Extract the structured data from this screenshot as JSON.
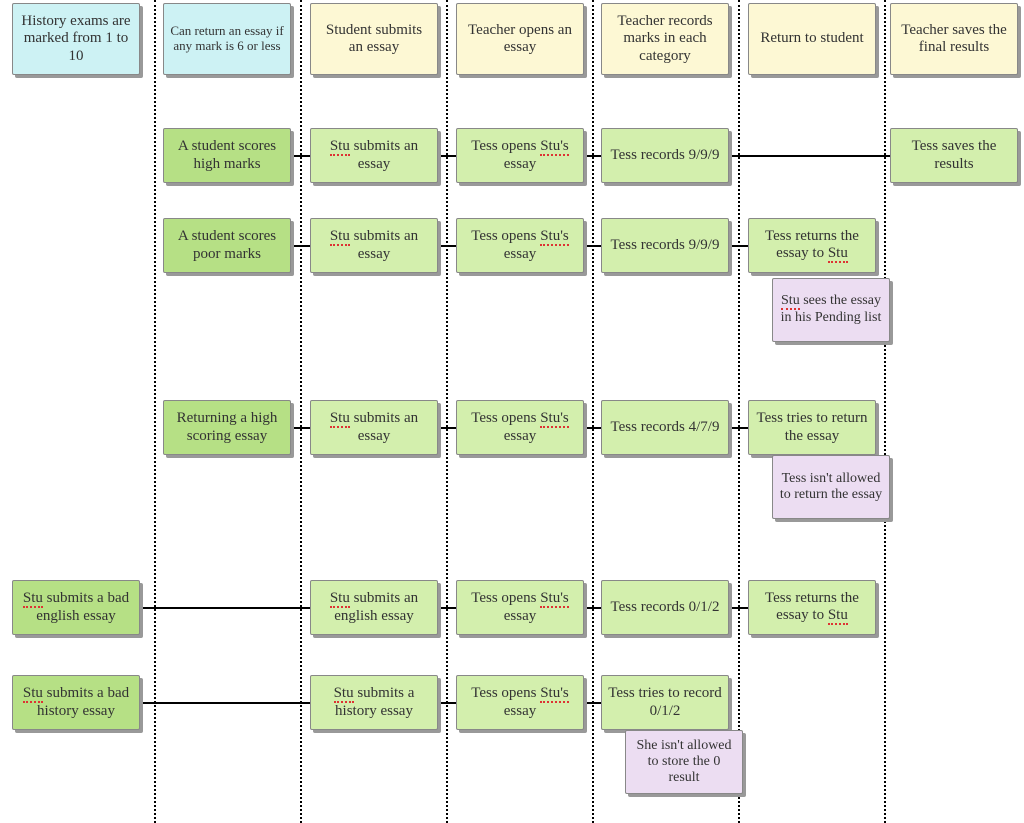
{
  "columns": {
    "x": [
      154,
      300,
      446,
      592,
      738,
      884,
      1024
    ]
  },
  "rules": {
    "history": "History exams are marked from 1 to 10",
    "return6": "Can return an essay if any mark is 6 or less"
  },
  "headers": {
    "c1": "Student submits an essay",
    "c2": "Teacher opens an essay",
    "c3": "Teacher records marks in each category",
    "c4": "Return to student",
    "c5": "Teacher saves the final results"
  },
  "rows": {
    "r1": {
      "title": "A student scores high marks",
      "c1": {
        "pre": "Stu",
        "post": " submits an essay"
      },
      "c2": {
        "pre": "Tess opens ",
        "mid": "Stu's",
        "post": " essay"
      },
      "c3": "Tess records 9/9/9",
      "c5": "Tess saves the results"
    },
    "r2": {
      "title": "A student scores poor marks",
      "c1": {
        "pre": "Stu",
        "post": " submits an essay"
      },
      "c2": {
        "pre": "Tess opens ",
        "mid": "Stu's",
        "post": " essay"
      },
      "c3": "Tess records 9/9/9",
      "c4": {
        "pre": "Tess returns the essay to ",
        "mid": "Stu"
      },
      "note": {
        "pre": "Stu",
        "post": " sees the essay in his Pending list"
      }
    },
    "r3": {
      "title": "Returning a high scoring essay",
      "c1": {
        "pre": "Stu",
        "post": " submits an essay"
      },
      "c2": {
        "pre": "Tess opens ",
        "mid": "Stu's",
        "post": " essay"
      },
      "c3": "Tess records 4/7/9",
      "c4": "Tess tries to return the essay",
      "note": "Tess isn't allowed to return the essay"
    },
    "r4": {
      "title": {
        "pre": "Stu",
        "post": " submits a bad english essay"
      },
      "c1": {
        "pre": "Stu",
        "post": " submits  an english essay"
      },
      "c2": {
        "pre": "Tess opens ",
        "mid": "Stu's",
        "post": " essay"
      },
      "c3": "Tess records 0/1/2",
      "c4": {
        "pre": "Tess returns the essay to ",
        "mid": "Stu"
      }
    },
    "r5": {
      "title": {
        "pre": "Stu",
        "post": " submits a bad history essay"
      },
      "c1": {
        "pre": "Stu",
        "post": " submits a history essay"
      },
      "c2": {
        "pre": "Tess opens ",
        "mid": "Stu's",
        "post": " essay"
      },
      "c3": "Tess tries to record 0/1/2",
      "note": "She isn't allowed to store the 0 result"
    }
  },
  "geom": {
    "topY": 3,
    "topH": 72,
    "cardW": 128,
    "cardH": 55,
    "noteW": 118,
    "noteH": 64,
    "colX": {
      "A": 12,
      "B": 163,
      "C": 310,
      "D": 456,
      "E": 601,
      "F": 748,
      "G": 890
    },
    "rowY": {
      "r1": 128,
      "r2": 218,
      "r3": 400,
      "r4": 580,
      "r5": 675
    },
    "noteY": {
      "r2": 278,
      "r3": 455,
      "r5": 730
    },
    "noteX": {
      "r2": 772,
      "r3": 772,
      "r5": 625
    }
  }
}
